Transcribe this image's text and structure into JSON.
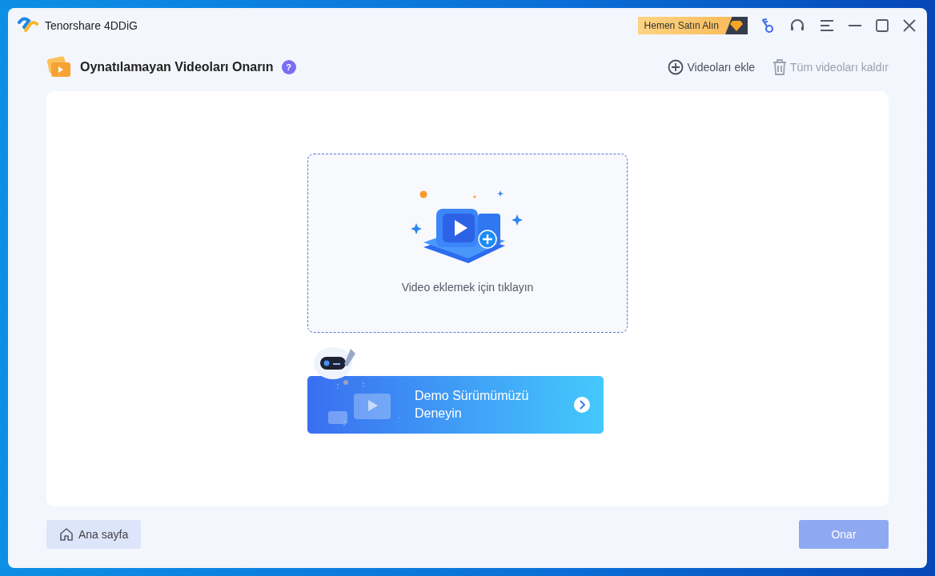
{
  "window": {
    "title": "Tenorshare 4DDiG"
  },
  "buy_button": {
    "label": "Hemen Satın Alın"
  },
  "header": {
    "title": "Oynatılamayan Videoları Onarın",
    "help_badge": "?"
  },
  "actions": [
    {
      "kind": "add",
      "label": "Videoları ekle",
      "disabled": false
    },
    {
      "kind": "remove",
      "label": "Tüm videoları kaldır",
      "disabled": true
    }
  ],
  "drop_zone": {
    "label": "Video eklemek için tıklayın"
  },
  "demo_banner": {
    "label": "Demo Sürümümüzü Deneyin"
  },
  "footer": {
    "home_button": {
      "label": "Ana sayfa"
    },
    "repair_button": {
      "label": "Onar",
      "disabled": true
    }
  }
}
